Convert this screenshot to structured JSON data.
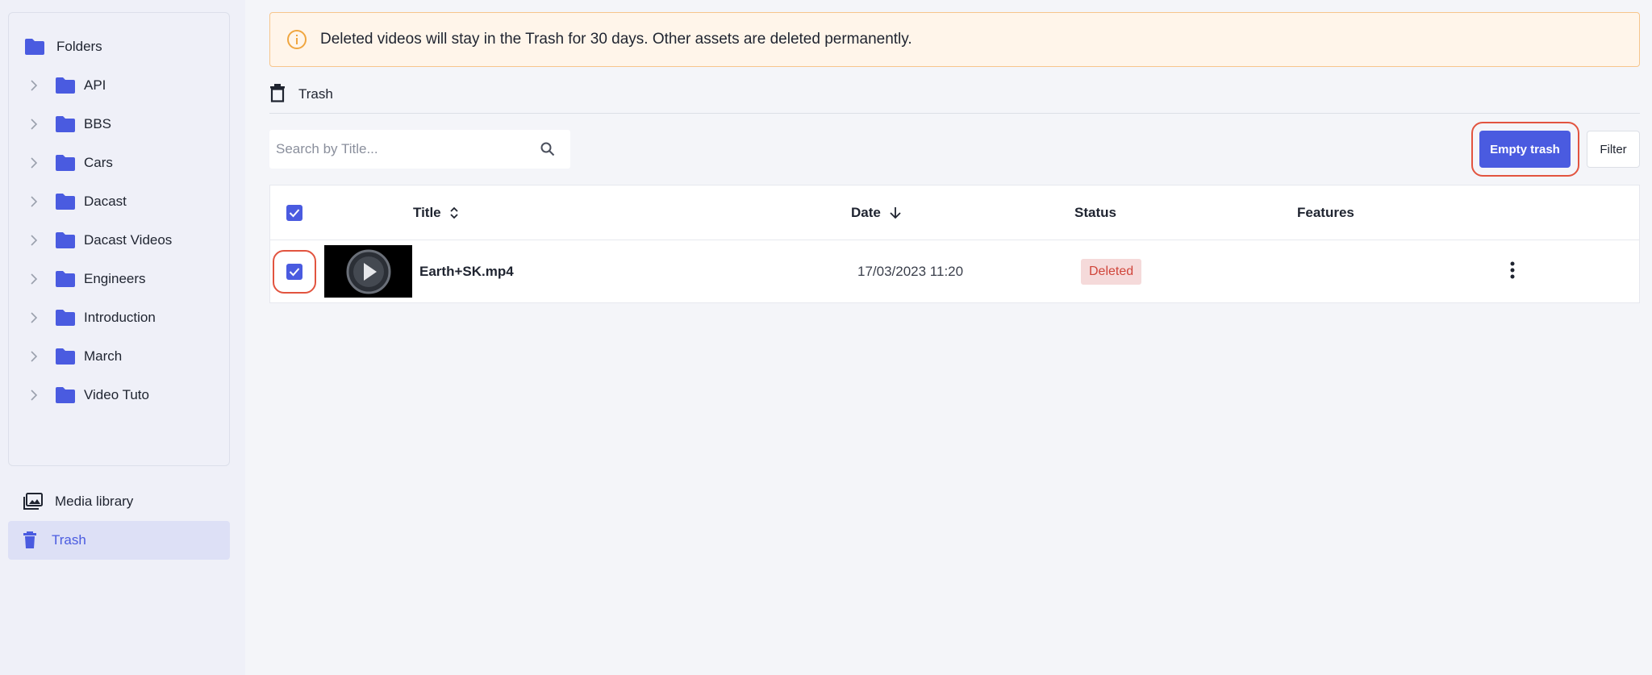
{
  "banner": {
    "icon": "info-icon",
    "text": "Deleted videos will stay in the Trash for 30 days. Other assets are deleted permanently."
  },
  "sidebar": {
    "root_label": "Folders",
    "folders": [
      {
        "label": "API"
      },
      {
        "label": "BBS"
      },
      {
        "label": "Cars"
      },
      {
        "label": "Dacast"
      },
      {
        "label": "Dacast Videos"
      },
      {
        "label": "Engineers"
      },
      {
        "label": "Introduction"
      },
      {
        "label": "March"
      },
      {
        "label": "Video Tuto"
      }
    ],
    "nav": [
      {
        "label": "Media library",
        "icon": "media-library-icon",
        "active": false
      },
      {
        "label": "Trash",
        "icon": "trash-icon",
        "active": true
      }
    ]
  },
  "page": {
    "title": "Trash",
    "icon": "trash-icon"
  },
  "search": {
    "placeholder": "Search by Title...",
    "value": ""
  },
  "toolbar": {
    "empty_trash_label": "Empty trash",
    "filter_label": "Filter"
  },
  "table": {
    "columns": [
      "Title",
      "Date",
      "Status",
      "Features"
    ],
    "select_all_checked": true,
    "rows": [
      {
        "checked": true,
        "title": "Earth+SK.mp4",
        "date": "17/03/2023 11:20",
        "status": "Deleted",
        "features": ""
      }
    ]
  },
  "colors": {
    "accent": "#4a5be0",
    "banner_bg": "#fff5ea",
    "banner_border": "#f7c58c",
    "status_deleted_bg": "#f5dada",
    "status_deleted_text": "#d0453a",
    "highlight_ring": "#e2543f"
  }
}
